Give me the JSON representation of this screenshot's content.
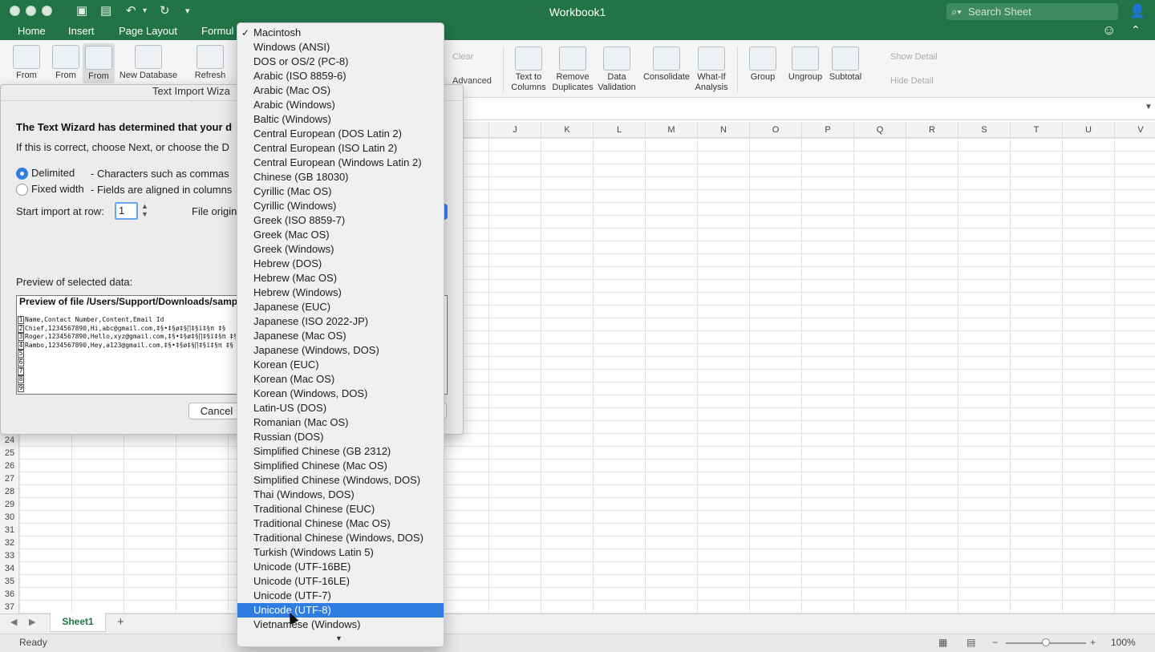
{
  "window": {
    "title": "Workbook1",
    "search_placeholder": "Search Sheet"
  },
  "ribbon_tabs": [
    "Home",
    "Insert",
    "Page Layout",
    "Formul"
  ],
  "ribbon": {
    "left_buttons": [
      "From",
      "From",
      "From",
      "New Database",
      "Refresh"
    ],
    "clear": "Clear",
    "advanced": "Advanced",
    "text_to_columns": [
      "Text to",
      "Columns"
    ],
    "remove_duplicates": [
      "Remove",
      "Duplicates"
    ],
    "data_validation": [
      "Data",
      "Validation"
    ],
    "consolidate": "Consolidate",
    "what_if": [
      "What-If",
      "Analysis"
    ],
    "group": "Group",
    "ungroup": "Ungroup",
    "subtotal": "Subtotal",
    "show_detail": "Show Detail",
    "hide_detail": "Hide Detail"
  },
  "columns": [
    "J",
    "K",
    "L",
    "M",
    "N",
    "O",
    "P",
    "Q",
    "R",
    "S",
    "T",
    "U",
    "V"
  ],
  "rows": [
    "24",
    "25",
    "26",
    "27",
    "28",
    "29",
    "30",
    "31",
    "32",
    "33",
    "34",
    "35",
    "36",
    "37"
  ],
  "sheet": {
    "tab": "Sheet1",
    "add": "+"
  },
  "status": {
    "ready": "Ready",
    "zoom": "100%",
    "zoom_level": 0.5
  },
  "dialog": {
    "title": "Text Import Wiza",
    "heading": "The Text Wizard has determined that your d",
    "subheading": "If this is correct, choose Next, or choose the D",
    "delimited_label": "Delimited",
    "delimited_desc": "- Characters such as commas",
    "fixed_label": "Fixed width",
    "fixed_desc": "- Fields are aligned in columns",
    "start_row_label": "Start import at row:",
    "start_row_value": "1",
    "file_origin_label": "File origin",
    "preview_label": "Preview of selected data:",
    "preview_header": "Preview of file /Users/Support/Downloads/samp",
    "preview_lines": [
      {
        "n": "1",
        "text": "Name,Contact Number,Content,Email Id"
      },
      {
        "n": "2",
        "text": "Chief,1234567890,Hi,abc@gmail.com,‡§•‡§ø‡§∏‡§ï‡§π ‡§"
      },
      {
        "n": "3",
        "text": "Roger,1234567890,Hello,xyz@gmail.com,‡§•‡§ø‡§∏‡§ï‡§π ‡§"
      },
      {
        "n": "4",
        "text": "Rambo,1234567890,Hey,a123@gmail.com,‡§•‡§ø‡§∏‡§ï‡§π ‡§"
      },
      {
        "n": "5",
        "text": ""
      },
      {
        "n": "6",
        "text": ""
      },
      {
        "n": "7",
        "text": ""
      },
      {
        "n": "8",
        "text": ""
      },
      {
        "n": "9",
        "text": ""
      }
    ],
    "cancel": "Cancel"
  },
  "encoding_menu": {
    "checked": "Macintosh",
    "highlighted": "Unicode (UTF-8)",
    "items": [
      "Macintosh",
      "Windows (ANSI)",
      "DOS or OS/2 (PC-8)",
      "Arabic (ISO 8859-6)",
      "Arabic (Mac OS)",
      "Arabic (Windows)",
      "Baltic (Windows)",
      "Central European (DOS Latin 2)",
      "Central European (ISO Latin 2)",
      "Central European (Windows Latin 2)",
      "Chinese (GB 18030)",
      "Cyrillic (Mac OS)",
      "Cyrillic (Windows)",
      "Greek (ISO 8859-7)",
      "Greek (Mac OS)",
      "Greek (Windows)",
      "Hebrew (DOS)",
      "Hebrew (Mac OS)",
      "Hebrew (Windows)",
      "Japanese (EUC)",
      "Japanese (ISO 2022-JP)",
      "Japanese (Mac OS)",
      "Japanese (Windows, DOS)",
      "Korean (EUC)",
      "Korean (Mac OS)",
      "Korean (Windows, DOS)",
      "Latin-US (DOS)",
      "Romanian (Mac OS)",
      "Russian (DOS)",
      "Simplified Chinese (GB 2312)",
      "Simplified Chinese (Mac OS)",
      "Simplified Chinese (Windows, DOS)",
      "Thai (Windows, DOS)",
      "Traditional Chinese (EUC)",
      "Traditional Chinese (Mac OS)",
      "Traditional Chinese (Windows, DOS)",
      "Turkish (Windows Latin 5)",
      "Unicode (UTF-16BE)",
      "Unicode (UTF-16LE)",
      "Unicode (UTF-7)",
      "Unicode (UTF-8)",
      "Vietnamese (Windows)"
    ]
  },
  "colors": {
    "excel_green": "#227447",
    "menu_highlight": "#2f7de1"
  }
}
